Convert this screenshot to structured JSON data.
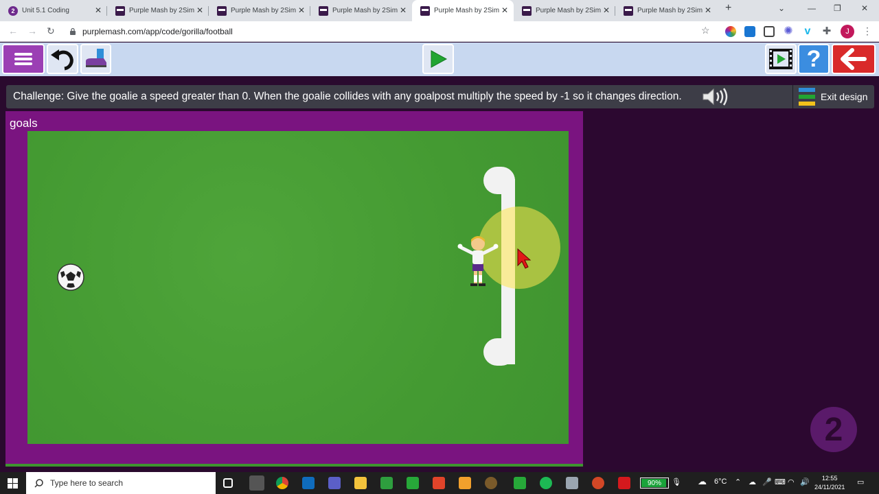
{
  "browser": {
    "tabs": [
      {
        "title": "Unit 5.1 Coding",
        "favicon": "purple-mash-2-icon",
        "active": false
      },
      {
        "title": "Purple Mash by 2Sim",
        "favicon": "purple-mash-icon",
        "active": false
      },
      {
        "title": "Purple Mash by 2Sim",
        "favicon": "purple-mash-icon",
        "active": false
      },
      {
        "title": "Purple Mash by 2Sim",
        "favicon": "purple-mash-icon",
        "active": false
      },
      {
        "title": "Purple Mash by 2Sim",
        "favicon": "purple-mash-icon",
        "active": true
      },
      {
        "title": "Purple Mash by 2Sim",
        "favicon": "purple-mash-icon",
        "active": false
      },
      {
        "title": "Purple Mash by 2Sim",
        "favicon": "purple-mash-icon",
        "active": false
      }
    ],
    "url": "purplemash.com/app/code/gorilla/football",
    "profile_initial": "J"
  },
  "toolbar": {
    "buttons": [
      "menu-icon",
      "undo-icon",
      "shoe-icon",
      "play-icon",
      "film-icon",
      "help-icon",
      "back-arrow-icon"
    ],
    "help_label": "?"
  },
  "challenge": {
    "text": "Challenge: Give the goalie a speed greater than 0. When the goalie collides with any goalpost multiply the speed by -1 so it changes direction.",
    "exit_label": "Exit design"
  },
  "stage": {
    "title": "goals",
    "objects": [
      "football",
      "goalie",
      "goalpost"
    ]
  },
  "badge": "2",
  "taskbar": {
    "search_placeholder": "Type here to search",
    "battery": "90%",
    "battery_level": 0.9,
    "temperature": "6°C",
    "time": "12:55",
    "date": "24/11/2021"
  },
  "colors": {
    "brand_purple": "#7a1480",
    "pitch_green": "#449a32",
    "accent_red": "#d92a2a",
    "accent_blue": "#3b8de0"
  }
}
